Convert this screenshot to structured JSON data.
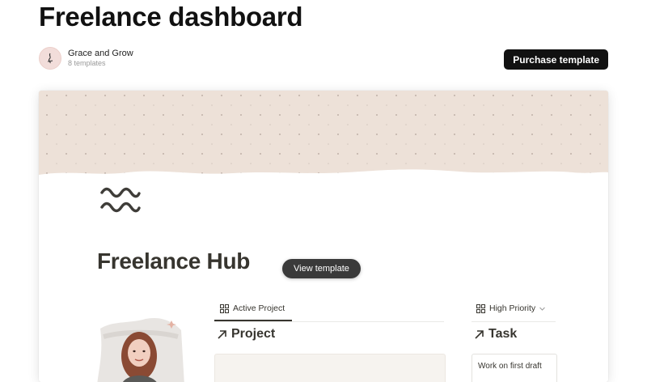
{
  "header": {
    "title": "Freelance dashboard",
    "creator_name": "Grace and Grow",
    "creator_count": "8 templates",
    "purchase_label": "Purchase template"
  },
  "preview": {
    "hub_title": "Freelance Hub",
    "view_label": "View template",
    "tabs": {
      "active_project": "Active Project",
      "high_priority": "High Priority"
    },
    "sections": {
      "project": "Project",
      "task": "Task"
    },
    "task_item": "Work on first draft"
  },
  "colors": {
    "cover_bg": "#ede1d8",
    "button_bg": "#111111",
    "text_dark": "#37352f"
  },
  "icons": [
    "signature-icon",
    "wave-logo-icon",
    "grid-icon",
    "chevron-down-icon",
    "arrow-up-right-icon"
  ]
}
